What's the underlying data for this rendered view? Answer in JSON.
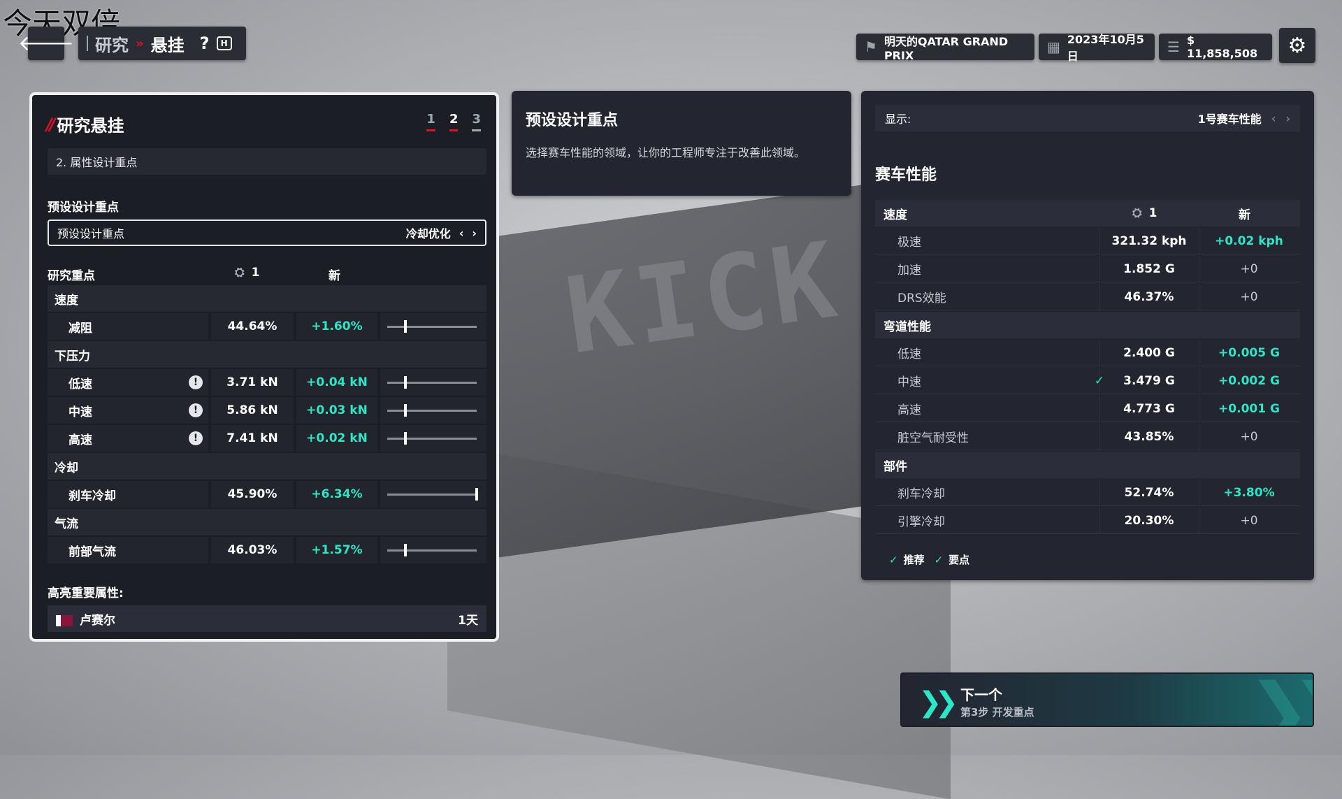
{
  "watermark": "今天双倍",
  "nav": {
    "back_icon": "arrow-left-icon",
    "crumb_parent": "研究",
    "crumb_separator": "»",
    "crumb_current": "悬挂",
    "help_label": "?",
    "help_key": "H"
  },
  "status": {
    "event": "明天的QATAR GRAND PRIX",
    "date": "2023年10月5日",
    "money": "$ 11,858,508"
  },
  "left_panel": {
    "title": "研究悬挂",
    "steps": [
      "1",
      "2",
      "3"
    ],
    "active_step": "2",
    "subheader": "2. 属性设计重点",
    "preset_section_label": "预设设计重点",
    "preset_field_label": "预设设计重点",
    "preset_value": "冷却优化",
    "col_focus": "研究重点",
    "col_car": "1",
    "col_new": "新",
    "categories": [
      {
        "name": "速度",
        "items": [
          {
            "name": "减阻",
            "value": "44.64%",
            "delta": "+1.60%",
            "slider": 0.2,
            "warn": false
          }
        ]
      },
      {
        "name": "下压力",
        "items": [
          {
            "name": "低速",
            "value": "3.71 kN",
            "delta": "+0.04 kN",
            "slider": 0.2,
            "warn": true
          },
          {
            "name": "中速",
            "value": "5.86 kN",
            "delta": "+0.03 kN",
            "slider": 0.2,
            "warn": true
          },
          {
            "name": "高速",
            "value": "7.41 kN",
            "delta": "+0.02 kN",
            "slider": 0.2,
            "warn": true
          }
        ]
      },
      {
        "name": "冷却",
        "items": [
          {
            "name": "刹车冷却",
            "value": "45.90%",
            "delta": "+6.34%",
            "slider": 1.0,
            "warn": false
          }
        ]
      },
      {
        "name": "气流",
        "items": [
          {
            "name": "前部气流",
            "value": "46.03%",
            "delta": "+1.57%",
            "slider": 0.2,
            "warn": false
          }
        ]
      }
    ],
    "highlight_label": "高亮重要属性:",
    "driver_name": "卢赛尔",
    "driver_days": "1天"
  },
  "mid_panel": {
    "title": "预设设计重点",
    "description": "选择赛车性能的领域，让你的工程师专注于改善此领域。"
  },
  "right_panel": {
    "display_label": "显示:",
    "display_value": "1号赛车性能",
    "title": "赛车性能",
    "col_car": "1",
    "col_new": "新",
    "sections": [
      {
        "name": "速度",
        "rows": [
          {
            "name": "极速",
            "value": "321.32 kph",
            "delta": "+0.02 kph",
            "positive": true,
            "tick": false
          },
          {
            "name": "加速",
            "value": "1.852 G",
            "delta": "+0",
            "positive": false,
            "tick": false
          },
          {
            "name": "DRS效能",
            "value": "46.37%",
            "delta": "+0",
            "positive": false,
            "tick": false
          }
        ]
      },
      {
        "name": "弯道性能",
        "rows": [
          {
            "name": "低速",
            "value": "2.400 G",
            "delta": "+0.005 G",
            "positive": true,
            "tick": false
          },
          {
            "name": "中速",
            "value": "3.479 G",
            "delta": "+0.002 G",
            "positive": true,
            "tick": true
          },
          {
            "name": "高速",
            "value": "4.773 G",
            "delta": "+0.001 G",
            "positive": true,
            "tick": false
          },
          {
            "name": "脏空气耐受性",
            "value": "43.85%",
            "delta": "+0",
            "positive": false,
            "tick": false
          }
        ]
      },
      {
        "name": "部件",
        "rows": [
          {
            "name": "刹车冷却",
            "value": "52.74%",
            "delta": "+3.80%",
            "positive": true,
            "tick": false
          },
          {
            "name": "引擎冷却",
            "value": "20.30%",
            "delta": "+0",
            "positive": false,
            "tick": false
          }
        ]
      }
    ],
    "legend_recommend": "推荐",
    "legend_key": "要点"
  },
  "next_button": {
    "label": "下一个",
    "sub": "第3步 开发重点"
  },
  "colors": {
    "accent": "#2de6c6",
    "brand_red": "#e0102a",
    "panel": "#232530"
  }
}
